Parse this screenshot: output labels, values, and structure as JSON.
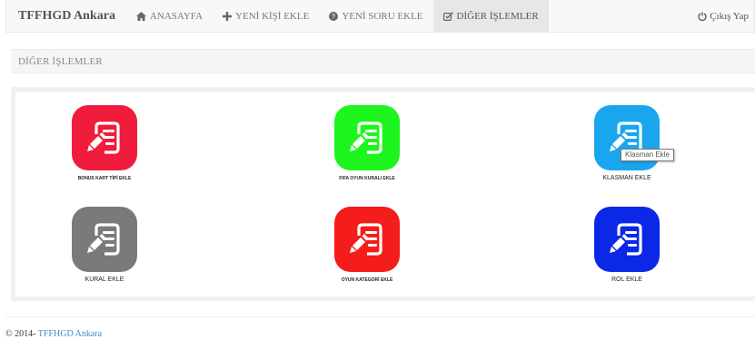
{
  "navbar": {
    "brand": "TFFHGD Ankara",
    "items": [
      {
        "label": "ANASAYFA",
        "icon": "home-icon"
      },
      {
        "label": "YENİ KİŞİ EKLE",
        "icon": "plus-icon"
      },
      {
        "label": "YENİ SORU EKLE",
        "icon": "question-circle-icon"
      },
      {
        "label": "DİĞER İŞLEMLER",
        "icon": "edit-icon",
        "active": true
      }
    ],
    "logout": {
      "label": "Çıkış Yap",
      "icon": "power-icon"
    }
  },
  "page_header": {
    "title": "DİĞER İŞLEMLER"
  },
  "tiles": [
    {
      "label": "BONUS KART TİPİ EKLE",
      "color": "#f01c3c",
      "icon": "document-edit-icon"
    },
    {
      "label": "FIFA OYUN KURALI EKLE",
      "color": "#1ef51e",
      "icon": "document-edit-icon"
    },
    {
      "label": "KLASMAN EKLE",
      "color": "#1aa6ee",
      "icon": "document-edit-icon"
    },
    {
      "label": "KURAL EKLE",
      "color": "#7a7a7a",
      "icon": "document-edit-icon"
    },
    {
      "label": "OYUN KATEGORİ EKLE",
      "color": "#f51c1c",
      "icon": "document-edit-icon"
    },
    {
      "label": "ROL EKLE",
      "color": "#0a28e6",
      "icon": "document-edit-icon"
    }
  ],
  "tooltip": {
    "text": "Klasman Ekle"
  },
  "footer": {
    "prefix": "© 2014-",
    "link_text": "TFFHGD Ankara"
  }
}
